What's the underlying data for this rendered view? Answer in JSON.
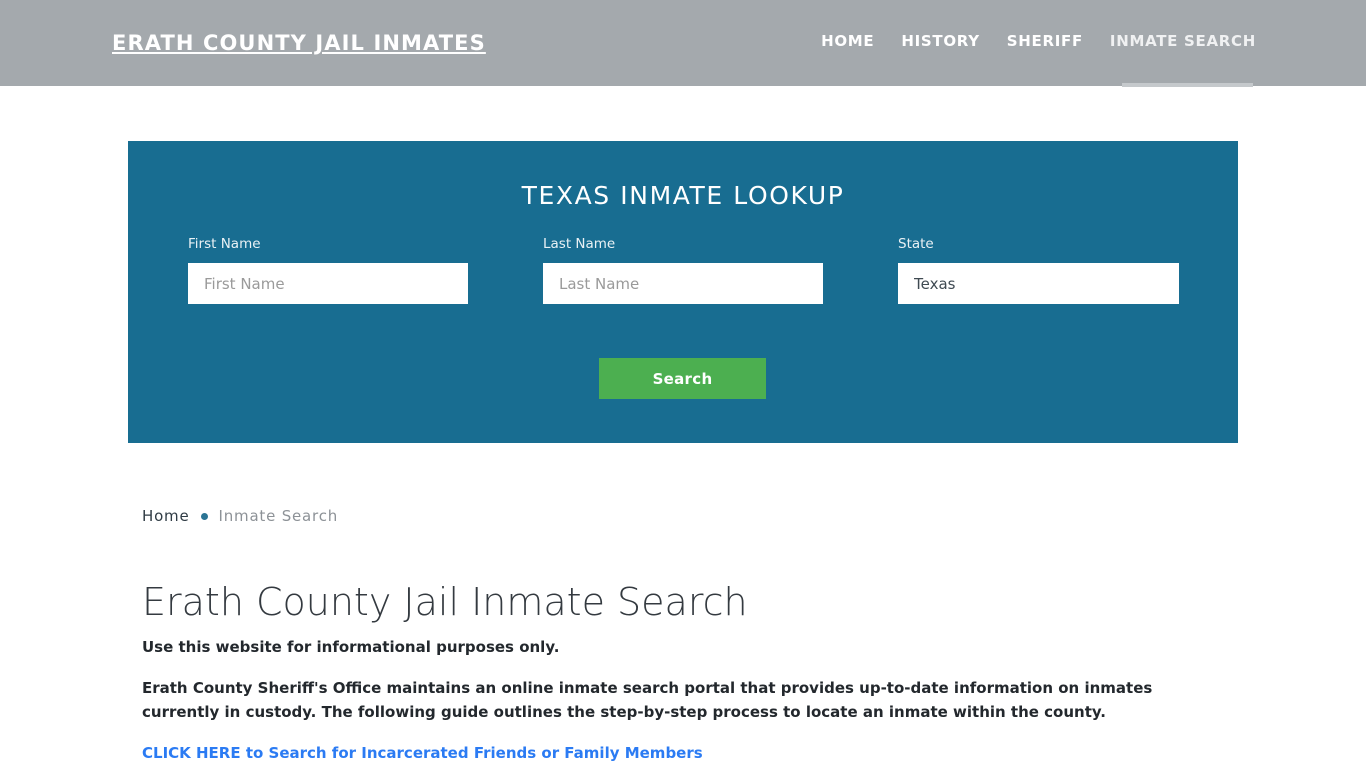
{
  "header": {
    "brand": "ERATH COUNTY JAIL INMATES",
    "nav": [
      {
        "label": "HOME",
        "active": false
      },
      {
        "label": "HISTORY",
        "active": false
      },
      {
        "label": "SHERIFF",
        "active": false
      },
      {
        "label": "INMATE SEARCH",
        "active": true
      }
    ],
    "background_color": "#a4a9ad",
    "active_indicator_color": "#c5c9cc"
  },
  "lookup": {
    "title": "TEXAS INMATE LOOKUP",
    "background_color": "#186d91",
    "fields": {
      "first_name": {
        "label": "First Name",
        "value": "",
        "placeholder": "First Name"
      },
      "last_name": {
        "label": "Last Name",
        "value": "",
        "placeholder": "Last Name"
      },
      "state": {
        "label": "State",
        "value": "Texas",
        "placeholder": "State"
      }
    },
    "submit": {
      "label": "Search",
      "color": "#4caf50"
    }
  },
  "breadcrumb": {
    "home": "Home",
    "separator": "•",
    "current": "Inmate Search",
    "separator_color": "#2b7494"
  },
  "main": {
    "title": "Erath County Jail Inmate Search",
    "lead_note": "Use this website for informational purposes only.",
    "paragraph": "Erath County Sheriff's Office maintains an online inmate search portal that provides up-to-date information on inmates currently in custody. The following guide outlines the step-by-step process to locate an inmate within the county.",
    "cta_link": "CLICK HERE to Search for Incarcerated Friends or Family Members",
    "cta_color": "#2b7bf3"
  }
}
